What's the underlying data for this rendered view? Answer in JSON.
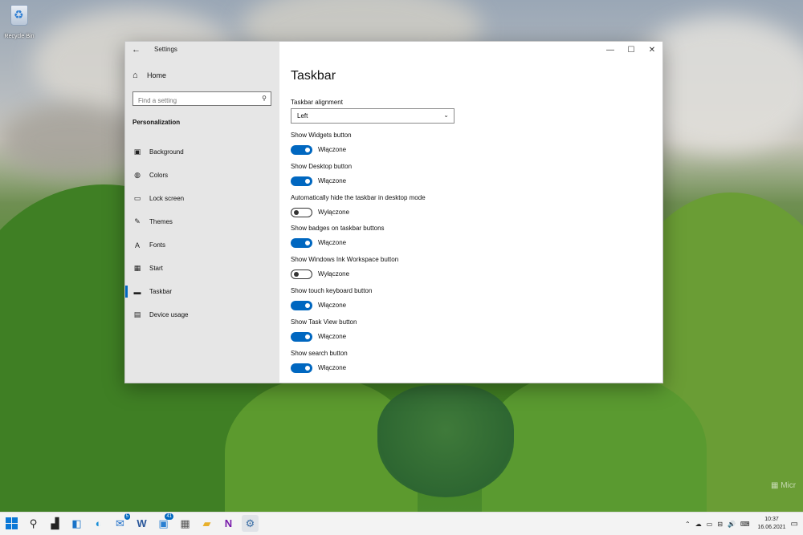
{
  "desktop": {
    "recycle_bin_label": "Recycle Bin"
  },
  "window": {
    "title": "Settings",
    "controls": [
      "—",
      "☐",
      "✕"
    ]
  },
  "sidebar": {
    "home": "Home",
    "search_placeholder": "Find a setting",
    "section": "Personalization",
    "items": [
      {
        "label": "Background",
        "icon": "image-icon",
        "glyph": "▣"
      },
      {
        "label": "Colors",
        "icon": "palette-icon",
        "glyph": "◍"
      },
      {
        "label": "Lock screen",
        "icon": "lock-screen-icon",
        "glyph": "▭"
      },
      {
        "label": "Themes",
        "icon": "brush-icon",
        "glyph": "✎"
      },
      {
        "label": "Fonts",
        "icon": "font-icon",
        "glyph": "A"
      },
      {
        "label": "Start",
        "icon": "start-icon",
        "glyph": "▦"
      },
      {
        "label": "Taskbar",
        "icon": "taskbar-icon",
        "glyph": "▬",
        "active": true
      },
      {
        "label": "Device usage",
        "icon": "device-icon",
        "glyph": "▤"
      }
    ]
  },
  "main": {
    "title": "Taskbar",
    "alignment": {
      "label": "Taskbar alignment",
      "value": "Left"
    },
    "settings": [
      {
        "label": "Show Widgets button",
        "state": "Włączone",
        "on": true
      },
      {
        "label": "Show Desktop button",
        "state": "Włączone",
        "on": true
      },
      {
        "label": "Automatically hide the taskbar in desktop mode",
        "state": "Wyłączone",
        "on": false
      },
      {
        "label": "Show badges on taskbar buttons",
        "state": "Włączone",
        "on": true
      },
      {
        "label": "Show Windows Ink Workspace button",
        "state": "Wyłączone",
        "on": false
      },
      {
        "label": "Show touch keyboard button",
        "state": "Włączone",
        "on": true
      },
      {
        "label": "Show Task View button",
        "state": "Włączone",
        "on": true
      },
      {
        "label": "Show search button",
        "state": "Włączone",
        "on": true
      }
    ]
  },
  "taskbar": {
    "apps": [
      {
        "name": "start-icon",
        "glyph": ""
      },
      {
        "name": "search-icon",
        "glyph": "⚲"
      },
      {
        "name": "task-view-icon",
        "glyph": "▟"
      },
      {
        "name": "widgets-icon",
        "glyph": "◧"
      },
      {
        "name": "edge-icon",
        "glyph": "◐"
      },
      {
        "name": "mail-icon",
        "glyph": "✉",
        "badge": "5"
      },
      {
        "name": "word-icon",
        "glyph": "W"
      },
      {
        "name": "store-icon",
        "glyph": "▣",
        "badge": "41"
      },
      {
        "name": "calculator-icon",
        "glyph": "▦"
      },
      {
        "name": "file-explorer-icon",
        "glyph": "▰"
      },
      {
        "name": "onenote-icon",
        "glyph": "N"
      },
      {
        "name": "settings-icon",
        "glyph": "⚙"
      }
    ],
    "tray_glyphs": [
      "⌃",
      "☁",
      "▭",
      "⊟",
      "🔊",
      "⌨"
    ],
    "time": "10:37",
    "date": "16.06.2021"
  },
  "colors": {
    "accent": "#0067c0",
    "sidebar": "#e6e6e6"
  }
}
